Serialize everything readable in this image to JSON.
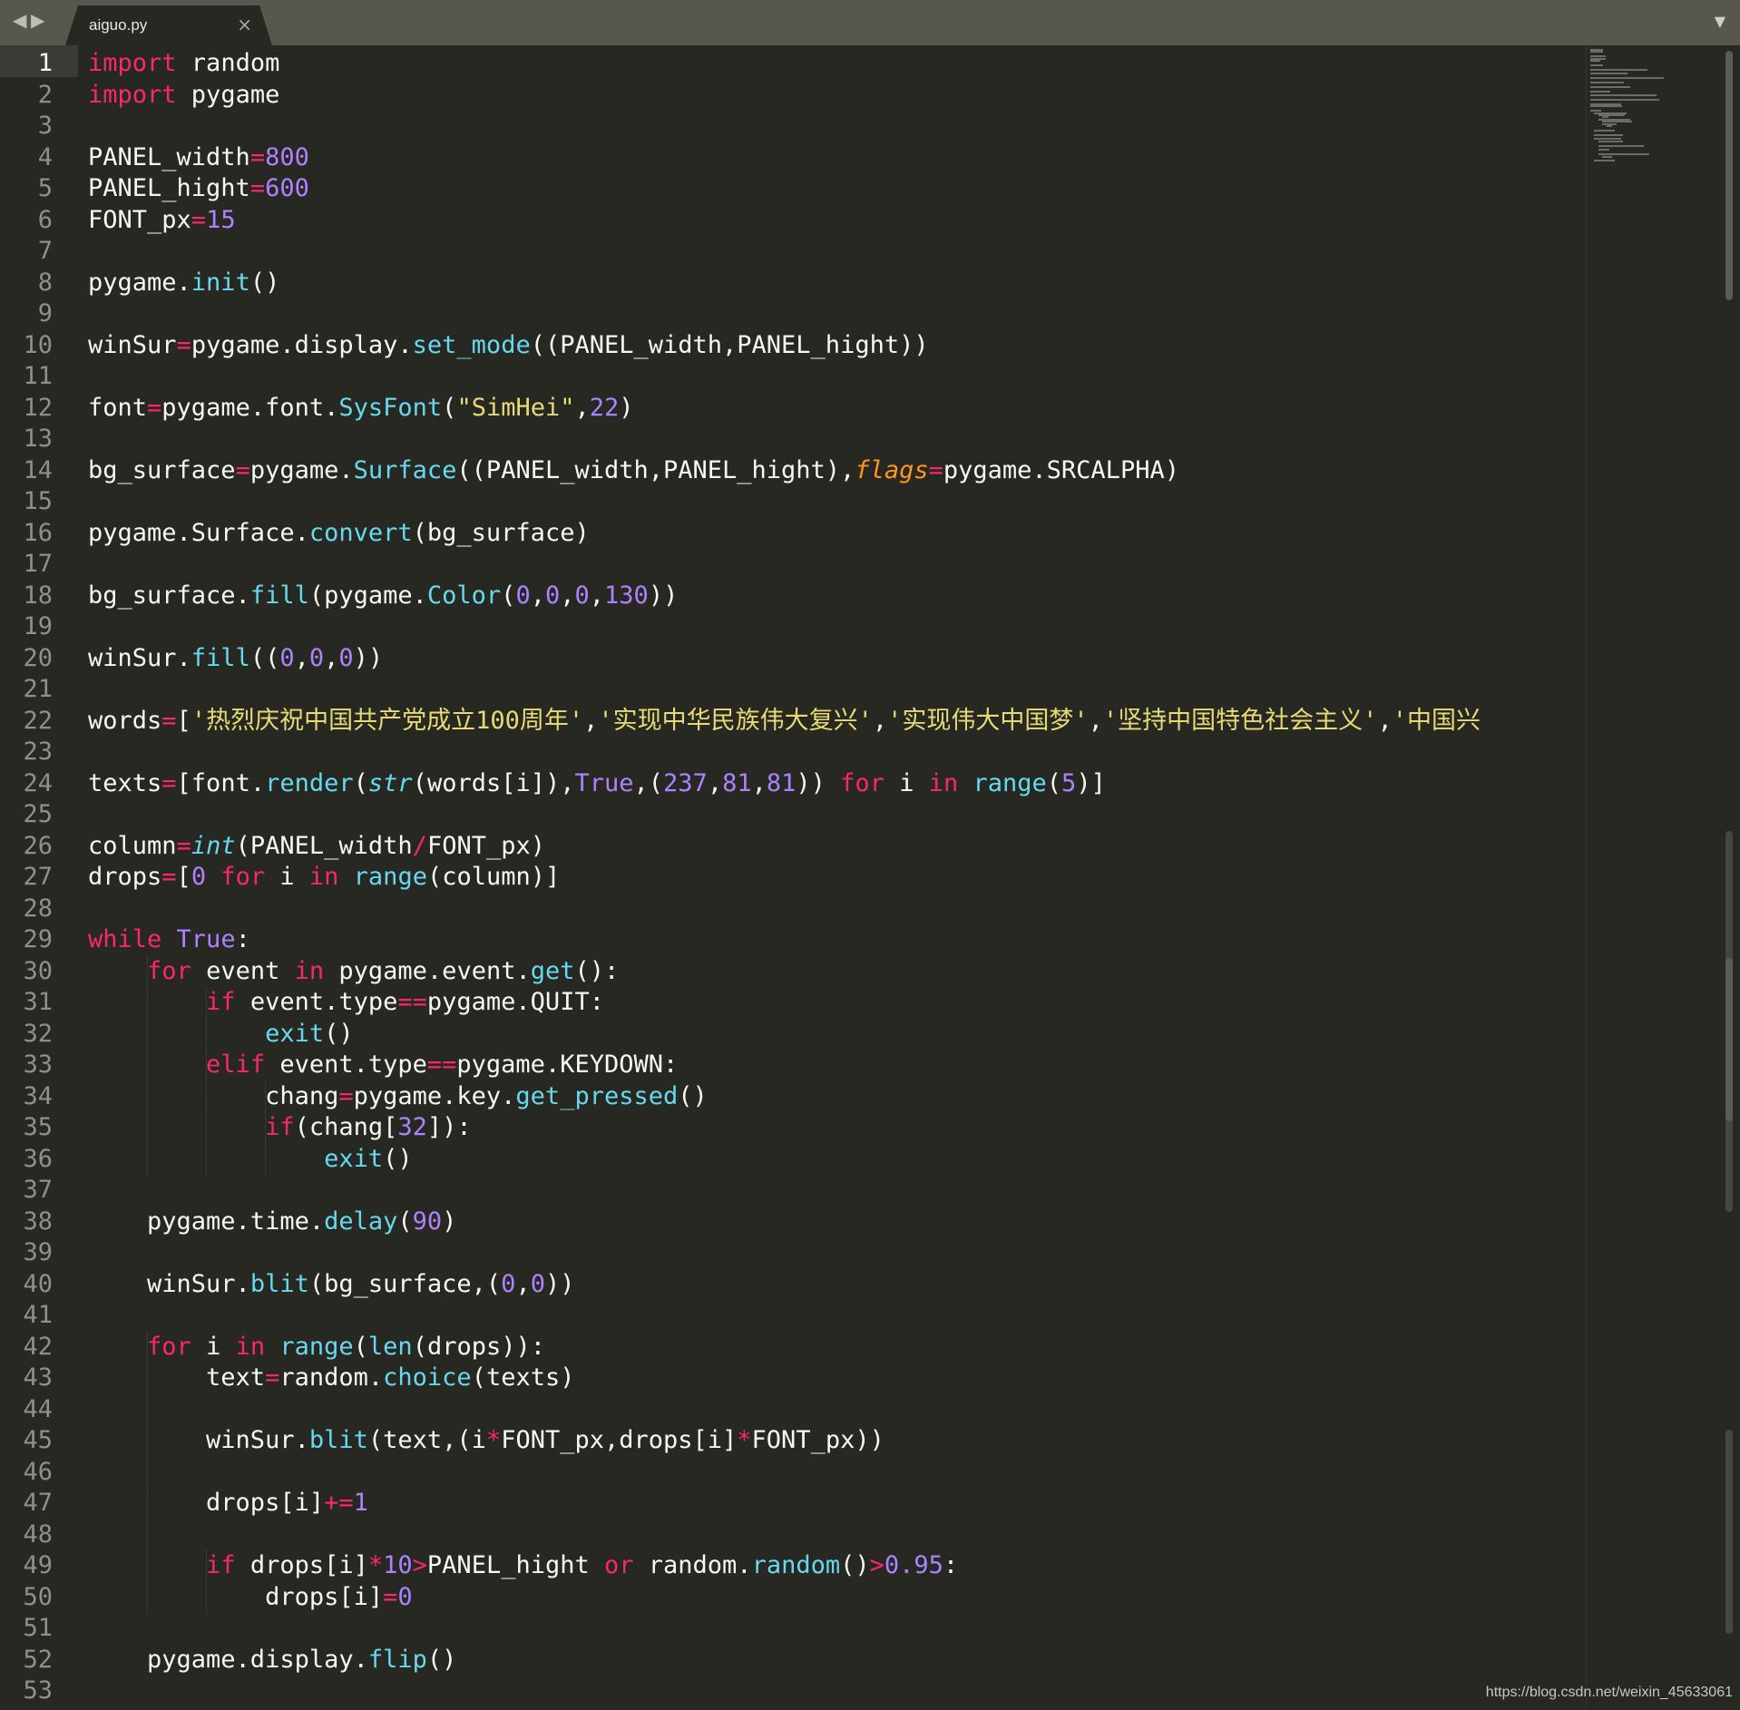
{
  "window": {
    "tab_title": "aiguo.py",
    "tab_close": "×",
    "nav_back": "◀",
    "nav_forward": "▶",
    "tab_dropdown": "▼"
  },
  "editor": {
    "active_line": 1,
    "line_numbers": [
      "1",
      "2",
      "3",
      "4",
      "5",
      "6",
      "7",
      "8",
      "9",
      "10",
      "11",
      "12",
      "13",
      "14",
      "15",
      "16",
      "17",
      "18",
      "19",
      "20",
      "21",
      "22",
      "23",
      "24",
      "25",
      "26",
      "27",
      "28",
      "29",
      "30",
      "31",
      "32",
      "33",
      "34",
      "35",
      "36",
      "37",
      "38",
      "39",
      "40",
      "41",
      "42",
      "43",
      "44",
      "45",
      "46",
      "47",
      "48",
      "49",
      "50",
      "51",
      "52",
      "53"
    ],
    "lines": [
      [
        [
          "kw",
          "import"
        ],
        [
          "t",
          " random"
        ]
      ],
      [
        [
          "kw",
          "import"
        ],
        [
          "t",
          " pygame"
        ]
      ],
      [],
      [
        [
          "t",
          "PANEL_width"
        ],
        [
          "op",
          "="
        ],
        [
          "num",
          "800"
        ]
      ],
      [
        [
          "t",
          "PANEL_hight"
        ],
        [
          "op",
          "="
        ],
        [
          "num",
          "600"
        ]
      ],
      [
        [
          "t",
          "FONT_px"
        ],
        [
          "op",
          "="
        ],
        [
          "num",
          "15"
        ]
      ],
      [],
      [
        [
          "t",
          "pygame."
        ],
        [
          "fn",
          "init"
        ],
        [
          "t",
          "()"
        ]
      ],
      [],
      [
        [
          "t",
          "winSur"
        ],
        [
          "op",
          "="
        ],
        [
          "t",
          "pygame.display."
        ],
        [
          "fn",
          "set_mode"
        ],
        [
          "t",
          "((PANEL_width,PANEL_hight))"
        ]
      ],
      [],
      [
        [
          "t",
          "font"
        ],
        [
          "op",
          "="
        ],
        [
          "t",
          "pygame.font."
        ],
        [
          "fn",
          "SysFont"
        ],
        [
          "t",
          "("
        ],
        [
          "str",
          "\"SimHei\""
        ],
        [
          "t",
          ","
        ],
        [
          "num",
          "22"
        ],
        [
          "t",
          ")"
        ]
      ],
      [],
      [
        [
          "t",
          "bg_surface"
        ],
        [
          "op",
          "="
        ],
        [
          "t",
          "pygame."
        ],
        [
          "fn",
          "Surface"
        ],
        [
          "t",
          "((PANEL_width,PANEL_hight),"
        ],
        [
          "param",
          "flags"
        ],
        [
          "op",
          "="
        ],
        [
          "t",
          "pygame.SRCALPHA)"
        ]
      ],
      [],
      [
        [
          "t",
          "pygame.Surface."
        ],
        [
          "fn",
          "convert"
        ],
        [
          "t",
          "(bg_surface)"
        ]
      ],
      [],
      [
        [
          "t",
          "bg_surface."
        ],
        [
          "fn",
          "fill"
        ],
        [
          "t",
          "(pygame."
        ],
        [
          "fn",
          "Color"
        ],
        [
          "t",
          "("
        ],
        [
          "num",
          "0"
        ],
        [
          "t",
          ","
        ],
        [
          "num",
          "0"
        ],
        [
          "t",
          ","
        ],
        [
          "num",
          "0"
        ],
        [
          "t",
          ","
        ],
        [
          "num",
          "130"
        ],
        [
          "t",
          "))"
        ]
      ],
      [],
      [
        [
          "t",
          "winSur."
        ],
        [
          "fn",
          "fill"
        ],
        [
          "t",
          "(("
        ],
        [
          "num",
          "0"
        ],
        [
          "t",
          ","
        ],
        [
          "num",
          "0"
        ],
        [
          "t",
          ","
        ],
        [
          "num",
          "0"
        ],
        [
          "t",
          "))"
        ]
      ],
      [],
      [
        [
          "t",
          "words"
        ],
        [
          "op",
          "="
        ],
        [
          "t",
          "["
        ],
        [
          "str",
          "'热烈庆祝中国共产党成立100周年'"
        ],
        [
          "t",
          ","
        ],
        [
          "str",
          "'实现中华民族伟大复兴'"
        ],
        [
          "t",
          ","
        ],
        [
          "str",
          "'实现伟大中国梦'"
        ],
        [
          "t",
          ","
        ],
        [
          "str",
          "'坚持中国特色社会主义'"
        ],
        [
          "t",
          ","
        ],
        [
          "str",
          "'中国兴"
        ]
      ],
      [],
      [
        [
          "t",
          "texts"
        ],
        [
          "op",
          "="
        ],
        [
          "t",
          "[font."
        ],
        [
          "fn",
          "render"
        ],
        [
          "t",
          "("
        ],
        [
          "typ",
          "str"
        ],
        [
          "t",
          "(words[i]),"
        ],
        [
          "const",
          "True"
        ],
        [
          "t",
          ",("
        ],
        [
          "num",
          "237"
        ],
        [
          "t",
          ","
        ],
        [
          "num",
          "81"
        ],
        [
          "t",
          ","
        ],
        [
          "num",
          "81"
        ],
        [
          "t",
          "))"
        ],
        [
          "kw",
          " for"
        ],
        [
          "t",
          " i"
        ],
        [
          "kw",
          " in"
        ],
        [
          "t",
          " "
        ],
        [
          "fn",
          "range"
        ],
        [
          "t",
          "("
        ],
        [
          "num",
          "5"
        ],
        [
          "t",
          ")]"
        ]
      ],
      [],
      [
        [
          "t",
          "column"
        ],
        [
          "op",
          "="
        ],
        [
          "typ",
          "int"
        ],
        [
          "t",
          "(PANEL_width"
        ],
        [
          "op",
          "/"
        ],
        [
          "t",
          "FONT_px)"
        ]
      ],
      [
        [
          "t",
          "drops"
        ],
        [
          "op",
          "="
        ],
        [
          "t",
          "["
        ],
        [
          "num",
          "0"
        ],
        [
          "kw",
          " for"
        ],
        [
          "t",
          " i"
        ],
        [
          "kw",
          " in"
        ],
        [
          "t",
          " "
        ],
        [
          "fn",
          "range"
        ],
        [
          "t",
          "(column)]"
        ]
      ],
      [],
      [
        [
          "kw",
          "while"
        ],
        [
          "t",
          " "
        ],
        [
          "const",
          "True"
        ],
        [
          "t",
          ":"
        ]
      ],
      [
        [
          "t",
          "    "
        ],
        [
          "kw",
          "for"
        ],
        [
          "t",
          " event"
        ],
        [
          "kw",
          " in"
        ],
        [
          "t",
          " pygame.event."
        ],
        [
          "fn",
          "get"
        ],
        [
          "t",
          "():"
        ]
      ],
      [
        [
          "t",
          "        "
        ],
        [
          "kw",
          "if"
        ],
        [
          "t",
          " event.type"
        ],
        [
          "op",
          "=="
        ],
        [
          "t",
          "pygame.QUIT:"
        ]
      ],
      [
        [
          "t",
          "            "
        ],
        [
          "fn",
          "exit"
        ],
        [
          "t",
          "()"
        ]
      ],
      [
        [
          "t",
          "        "
        ],
        [
          "kw",
          "elif"
        ],
        [
          "t",
          " event.type"
        ],
        [
          "op",
          "=="
        ],
        [
          "t",
          "pygame.KEYDOWN:"
        ]
      ],
      [
        [
          "t",
          "            chang"
        ],
        [
          "op",
          "="
        ],
        [
          "t",
          "pygame.key."
        ],
        [
          "fn",
          "get_pressed"
        ],
        [
          "t",
          "()"
        ]
      ],
      [
        [
          "t",
          "            "
        ],
        [
          "kw",
          "if"
        ],
        [
          "t",
          "(chang["
        ],
        [
          "num",
          "32"
        ],
        [
          "t",
          "]):"
        ]
      ],
      [
        [
          "t",
          "                "
        ],
        [
          "fn",
          "exit"
        ],
        [
          "t",
          "()"
        ]
      ],
      [],
      [
        [
          "t",
          "    pygame.time."
        ],
        [
          "fn",
          "delay"
        ],
        [
          "t",
          "("
        ],
        [
          "num",
          "90"
        ],
        [
          "t",
          ")"
        ]
      ],
      [],
      [
        [
          "t",
          "    winSur."
        ],
        [
          "fn",
          "blit"
        ],
        [
          "t",
          "(bg_surface,("
        ],
        [
          "num",
          "0"
        ],
        [
          "t",
          ","
        ],
        [
          "num",
          "0"
        ],
        [
          "t",
          "))"
        ]
      ],
      [],
      [
        [
          "t",
          "    "
        ],
        [
          "kw",
          "for"
        ],
        [
          "t",
          " i"
        ],
        [
          "kw",
          " in"
        ],
        [
          "t",
          " "
        ],
        [
          "fn",
          "range"
        ],
        [
          "t",
          "("
        ],
        [
          "fn",
          "len"
        ],
        [
          "t",
          "(drops)):"
        ]
      ],
      [
        [
          "t",
          "        text"
        ],
        [
          "op",
          "="
        ],
        [
          "t",
          "random."
        ],
        [
          "fn",
          "choice"
        ],
        [
          "t",
          "(texts)"
        ]
      ],
      [],
      [
        [
          "t",
          "        winSur."
        ],
        [
          "fn",
          "blit"
        ],
        [
          "t",
          "(text,(i"
        ],
        [
          "op",
          "*"
        ],
        [
          "t",
          "FONT_px,drops[i]"
        ],
        [
          "op",
          "*"
        ],
        [
          "t",
          "FONT_px))"
        ]
      ],
      [],
      [
        [
          "t",
          "        drops[i]"
        ],
        [
          "op",
          "+="
        ],
        [
          "num",
          "1"
        ]
      ],
      [],
      [
        [
          "t",
          "        "
        ],
        [
          "kw",
          "if"
        ],
        [
          "t",
          " drops[i]"
        ],
        [
          "op",
          "*"
        ],
        [
          "num",
          "10"
        ],
        [
          "op",
          ">"
        ],
        [
          "t",
          "PANEL_hight"
        ],
        [
          "kw",
          " or"
        ],
        [
          "t",
          " random."
        ],
        [
          "fn",
          "random"
        ],
        [
          "t",
          "()"
        ],
        [
          "op",
          ">"
        ],
        [
          "num",
          "0.95"
        ],
        [
          "t",
          ":"
        ]
      ],
      [
        [
          "t",
          "            drops[i]"
        ],
        [
          "op",
          "="
        ],
        [
          "num",
          "0"
        ]
      ],
      [],
      [
        [
          "t",
          "    pygame.display."
        ],
        [
          "fn",
          "flip"
        ],
        [
          "t",
          "()"
        ]
      ],
      []
    ]
  },
  "watermark": "https://blog.csdn.net/weixin_45633061"
}
